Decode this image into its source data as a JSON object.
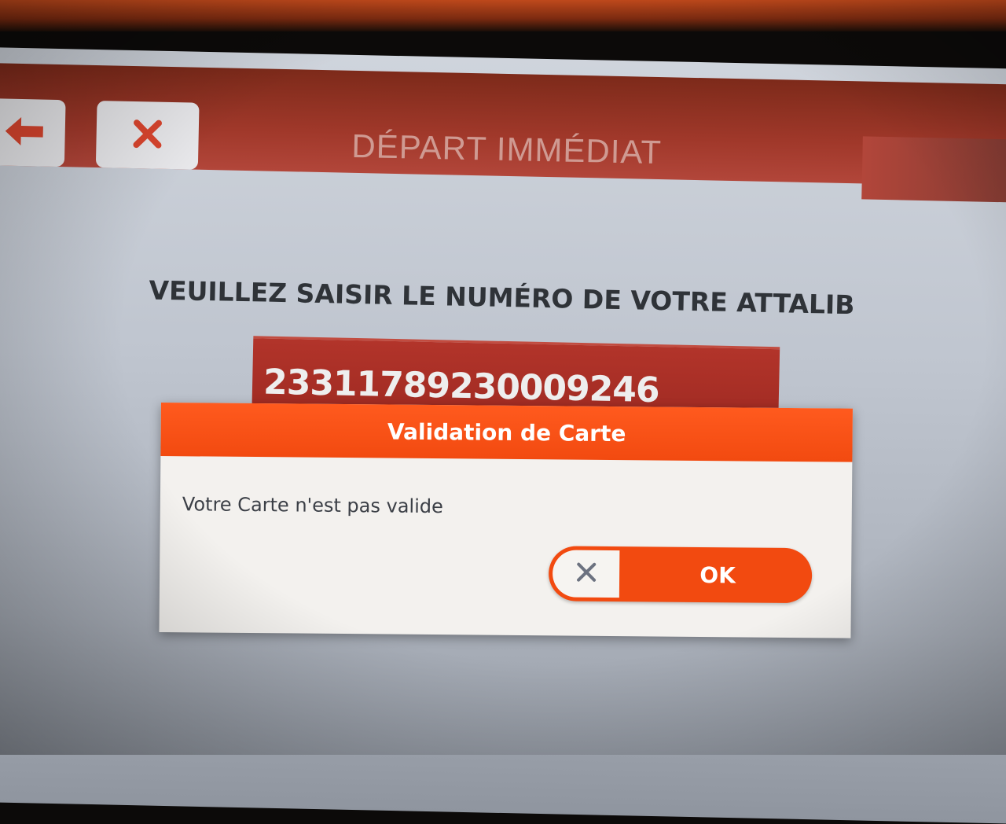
{
  "header": {
    "title": "DÉPART IMMÉDIAT",
    "back_icon": "arrow-left-icon",
    "close_icon": "close-icon"
  },
  "main": {
    "prompt": "VEUILLEZ SAISIR LE NUMÉRO DE VOTRE ATTALIB",
    "card_number": "23311789230009246"
  },
  "dialog": {
    "title": "Validation de Carte",
    "message": "Votre Carte n'est pas valide",
    "ok_label": "OK",
    "cancel_icon": "close-icon"
  },
  "colors": {
    "accent": "#f24a10",
    "header_bar": "#a0382a",
    "card_field": "#b2342a"
  }
}
